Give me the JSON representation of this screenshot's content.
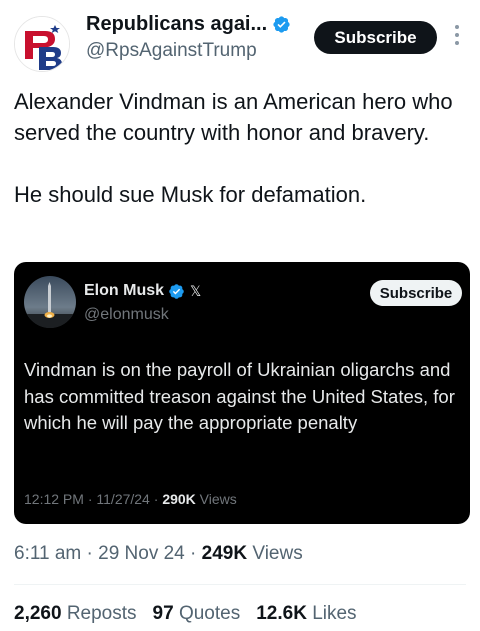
{
  "author": {
    "display_name": "Republicans agai...",
    "handle": "@RpsAgainstTrump",
    "avatar_icon": "rb-logo-icon",
    "verified": true
  },
  "subscribe_label": "Subscribe",
  "tweet_text": "Alexander Vindman is an American hero who served the country with honor and bravery.\n\nHe should sue Musk for defamation.",
  "quote": {
    "display_name": "Elon Musk",
    "handle": "@elonmusk",
    "x_mark": "𝕏",
    "subscribe_label": "Subscribe",
    "text": "Vindman is on the payroll of Ukrainian oligarchs and has committed treason against the United States, for which he will pay the appropriate penalty",
    "time": "12:12 PM",
    "date": "11/27/24",
    "views_count": "290K",
    "views_label": "Views"
  },
  "meta": {
    "time": "6:11 am",
    "date": "29 Nov 24",
    "views_count": "249K",
    "views_label": "Views"
  },
  "stats": {
    "reposts_count": "2,260",
    "reposts_label": "Reposts",
    "quotes_count": "97",
    "quotes_label": "Quotes",
    "likes_count": "12.6K",
    "likes_label": "Likes"
  },
  "colors": {
    "verified_blue": "#1d9bf0",
    "text_primary": "#0f1419",
    "text_secondary": "#536471",
    "quote_bg": "#000000"
  }
}
